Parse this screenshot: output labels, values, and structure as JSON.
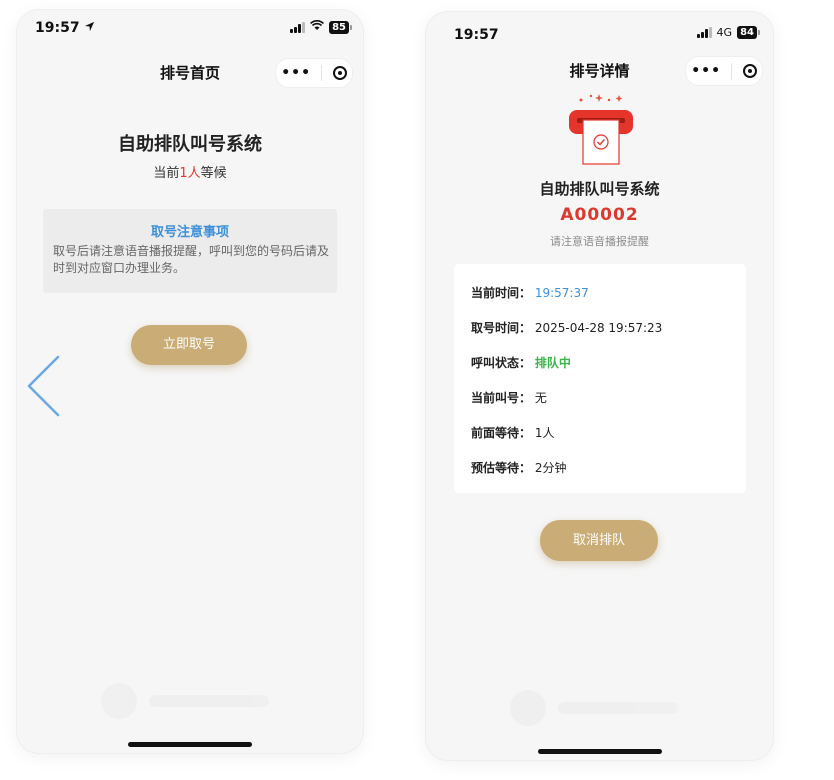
{
  "left_screen": {
    "status_time": "19:57",
    "battery": "85",
    "nav_title": "排号首页",
    "capsule_dots": "•••",
    "title": "自助排队叫号系统",
    "wait_prefix": "当前",
    "wait_count": "1人",
    "wait_suffix": "等候",
    "notice_title": "取号注意事项",
    "notice_body": "取号后请注意语音播报提醒，呼叫到您的号码后请及时到对应窗口办理业务。",
    "button_label": "立即取号"
  },
  "right_screen": {
    "status_time": "19:57",
    "network": "4G",
    "battery": "84",
    "nav_title": "排号详情",
    "capsule_dots": "•••",
    "title": "自助排队叫号系统",
    "ticket_number": "A00002",
    "hint": "请注意语音播报提醒",
    "details": [
      {
        "key": "当前时间：",
        "value": "19:57:37"
      },
      {
        "key": "取号时间：",
        "value": "2025-04-28 19:57:23"
      },
      {
        "key": "呼叫状态：",
        "value": "排队中"
      },
      {
        "key": "当前叫号：",
        "value": "无"
      },
      {
        "key": "前面等待：",
        "value": "1人"
      },
      {
        "key": "预估等待：",
        "value": "2分钟"
      }
    ],
    "button_label": "取消排队"
  },
  "colors": {
    "accent_gold": "#c9ac76",
    "number_red": "#d93a2d",
    "time_blue": "#3c8fd8",
    "status_green": "#3bb24a"
  },
  "icons": [
    "location-arrow-icon",
    "signal-icon",
    "wifi-icon",
    "battery-icon",
    "more-icon",
    "target-icon",
    "back-arrow-icon",
    "ticket-printer-icon"
  ]
}
